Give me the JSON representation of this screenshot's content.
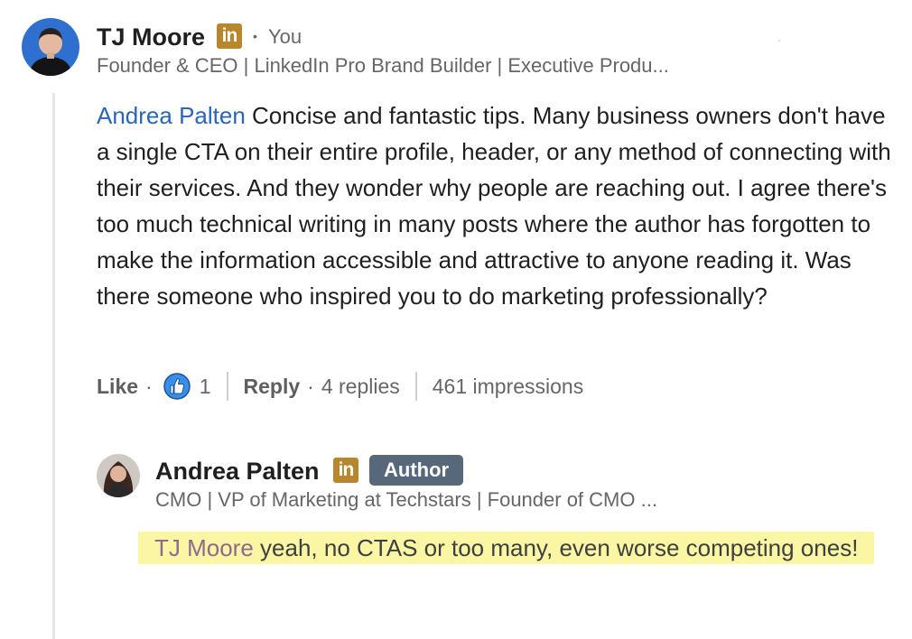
{
  "comment": {
    "author_name": "TJ Moore",
    "badge_text": "in",
    "relation": "You",
    "separator": "•",
    "headline": "Founder & CEO | LinkedIn Pro Brand Builder | Executive Produ...",
    "mention": "Andrea Palten",
    "text": " Concise and fantastic tips. Many business owners don't have a single CTA on their entire profile, header, or any method of connecting with their services. And they wonder why people are reaching out. I agree there's too much technical writing in many posts where the author has forgotten to make the information accessible and attractive to anyone reading it. Was there someone who inspired you to do marketing professionally?",
    "actions": {
      "like_label": "Like",
      "dot": "·",
      "reaction_count": "1",
      "reply_label": "Reply",
      "replies_count": "4 replies",
      "impressions": "461 impressions"
    }
  },
  "reply": {
    "author_name": "Andrea Palten",
    "badge_text": "in",
    "author_tag": "Author",
    "headline": "CMO | VP of Marketing at Techstars | Founder of CMO ...",
    "mention": "TJ Moore",
    "text": " yeah, no CTAS or too many, even worse competing ones!"
  },
  "colors": {
    "linkedin_badge": "#b8862d",
    "mention_blue": "#2a65b8",
    "author_tag_bg": "#56687a",
    "highlight": "#fbf6a4",
    "like_icon": "#378fe9"
  },
  "icons": {
    "badge": "linkedin-icon",
    "reaction": "like-thumb-icon"
  }
}
